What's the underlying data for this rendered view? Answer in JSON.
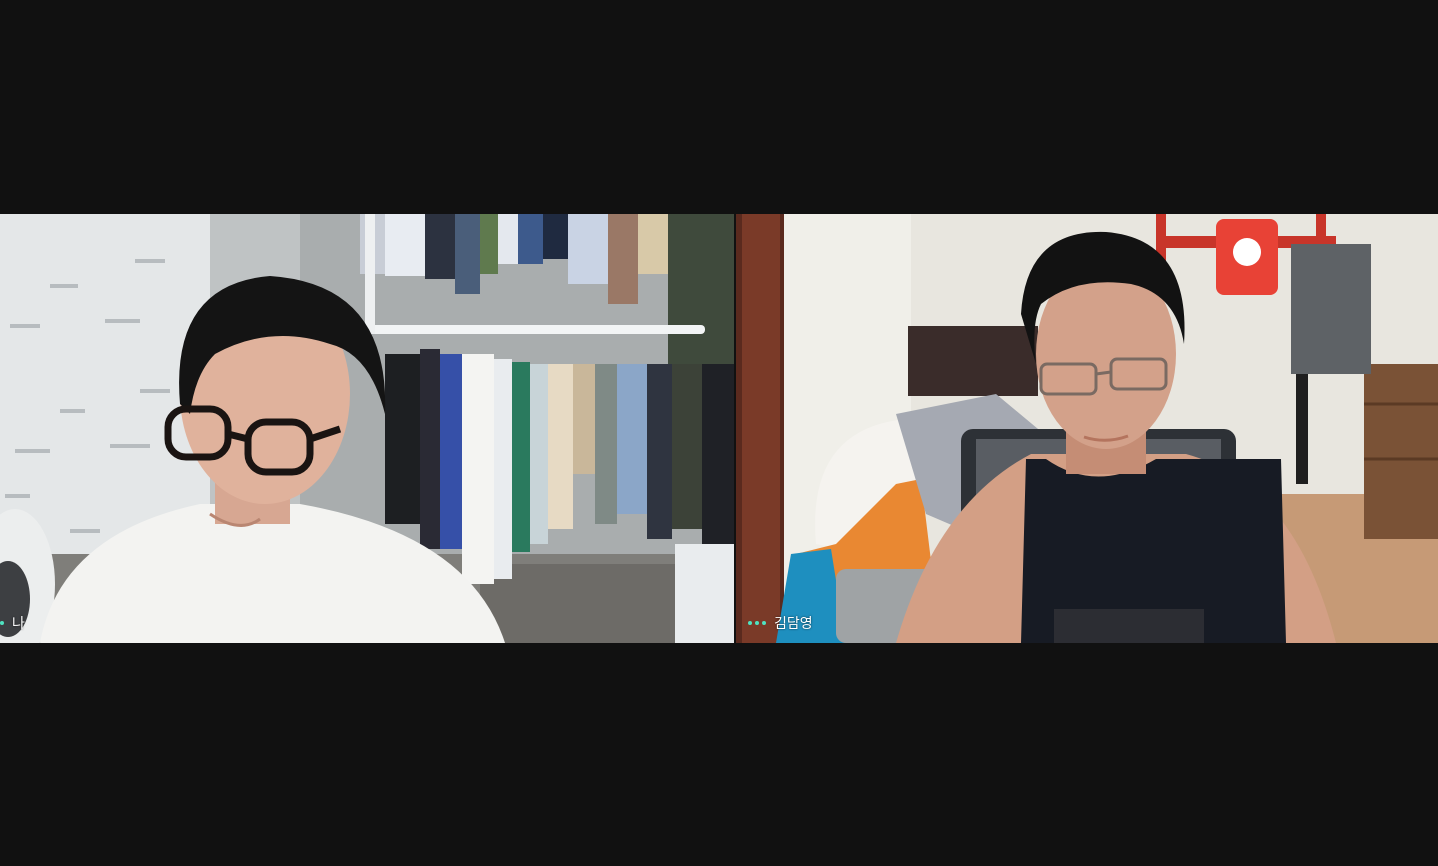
{
  "participants": [
    {
      "name": "나",
      "status_color": "#4fe3c1"
    },
    {
      "name": "김담영",
      "status_color": "#4fe3c1"
    }
  ],
  "colors": {
    "background": "#111111",
    "accent": "#4fe3c1"
  },
  "icons": {
    "speaking_indicator": "three-dots-icon"
  }
}
